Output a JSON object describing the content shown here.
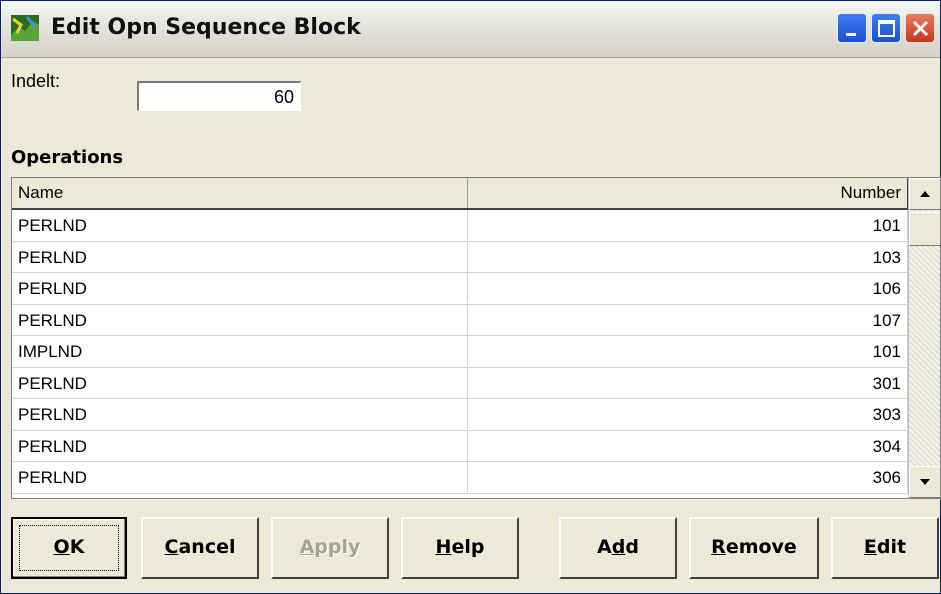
{
  "window": {
    "title": "Edit Opn Sequence Block",
    "controls": [
      "minimize-icon",
      "maximize-icon",
      "close-icon"
    ]
  },
  "indelt": {
    "label": "Indelt:",
    "value": "60"
  },
  "operations": {
    "label": "Operations",
    "columns": {
      "name": "Name",
      "number": "Number"
    },
    "rows": [
      {
        "name": "PERLND",
        "number": "101"
      },
      {
        "name": "PERLND",
        "number": "103"
      },
      {
        "name": "PERLND",
        "number": "106"
      },
      {
        "name": "PERLND",
        "number": "107"
      },
      {
        "name": "IMPLND",
        "number": "101"
      },
      {
        "name": "PERLND",
        "number": "301"
      },
      {
        "name": "PERLND",
        "number": "303"
      },
      {
        "name": "PERLND",
        "number": "304"
      },
      {
        "name": "PERLND",
        "number": "306"
      }
    ]
  },
  "buttons": {
    "ok": {
      "pre": "",
      "key": "O",
      "post": "K"
    },
    "cancel": {
      "pre": "",
      "key": "C",
      "post": "ancel"
    },
    "apply": {
      "pre": "",
      "key": "A",
      "post": "pply"
    },
    "help": {
      "pre": "",
      "key": "H",
      "post": "elp"
    },
    "add": {
      "pre": "A",
      "key": "d",
      "post": "d"
    },
    "remove": {
      "pre": "",
      "key": "R",
      "post": "emove"
    },
    "edit": {
      "pre": "",
      "key": "E",
      "post": "dit"
    }
  },
  "colors": {
    "dialog_bg": "#ece9d8",
    "title_text": "#111111",
    "disabled_text": "#a5a393"
  }
}
